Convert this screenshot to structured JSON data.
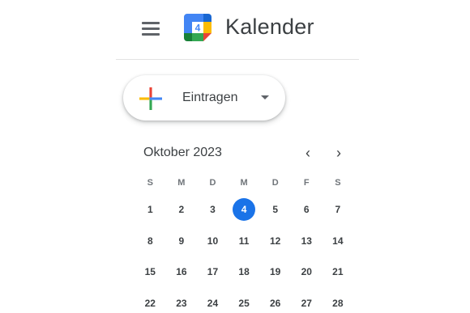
{
  "header": {
    "menu_icon": "hamburger-menu-icon",
    "logo_icon": "calendar-logo-icon",
    "logo_day": "4",
    "title": "Kalender"
  },
  "create": {
    "label": "Eintragen",
    "icon": "colorful-plus-icon",
    "caret_icon": "caret-down-icon"
  },
  "mini_calendar": {
    "month": "Oktober 2023",
    "prev_icon": "chevron-left-icon",
    "next_icon": "chevron-right-icon",
    "weekdays": [
      "S",
      "M",
      "D",
      "M",
      "D",
      "F",
      "S"
    ],
    "weeks": [
      [
        "1",
        "2",
        "3",
        "4",
        "5",
        "6",
        "7"
      ],
      [
        "8",
        "9",
        "10",
        "11",
        "12",
        "13",
        "14"
      ],
      [
        "15",
        "16",
        "17",
        "18",
        "19",
        "20",
        "21"
      ],
      [
        "22",
        "23",
        "24",
        "25",
        "26",
        "27",
        "28"
      ]
    ],
    "today": "4"
  },
  "colors": {
    "blue": "#4285f4",
    "red": "#ea4335",
    "yellow": "#fbbc04",
    "green": "#34a853",
    "today_fill": "#1a73e8",
    "text": "#3c4043"
  }
}
